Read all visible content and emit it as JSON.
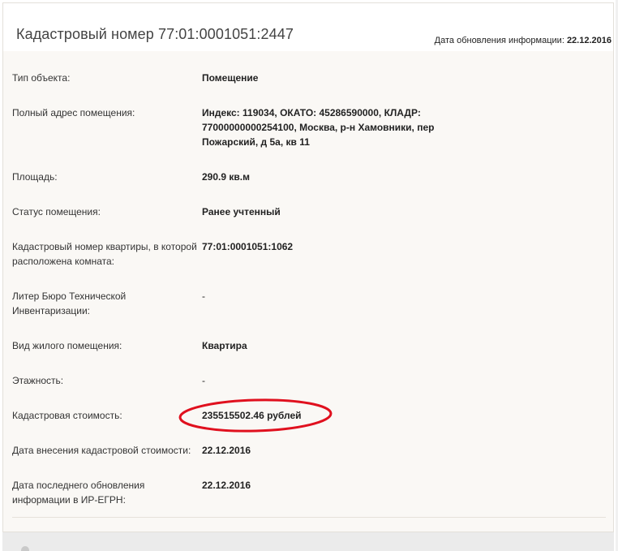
{
  "header": {
    "title": "Кадастровый номер 77:01:0001051:2447",
    "updated_label": "Дата обновления информации:",
    "updated_value": "22.12.2016"
  },
  "rows": [
    {
      "label": "Тип объекта:",
      "value": "Помещение"
    },
    {
      "label": "Полный адрес помещения:",
      "value": "Индекс: 119034, ОКАТО: 45286590000, КЛАДР: 77000000000254100, Москва, р-н Хамовники, пер Пожарский, д 5а, кв 11"
    },
    {
      "label": "Площадь:",
      "value": "290.9 кв.м"
    },
    {
      "label": "Статус помещения:",
      "value": "Ранее учтенный"
    },
    {
      "label": "Кадастровый номер квартиры, в которой расположена комната:",
      "value": "77:01:0001051:1062"
    },
    {
      "label": "Литер Бюро Технической Инвентаризации:",
      "value": "-"
    },
    {
      "label": "Вид жилого помещения:",
      "value": "Квартира"
    },
    {
      "label": "Этажность:",
      "value": "-"
    },
    {
      "label": "Кадастровая стоимость:",
      "value": "235515502.46 рублей"
    },
    {
      "label": "Дата внесения кадастровой стоимости:",
      "value": "22.12.2016"
    },
    {
      "label": "Дата последнего обновления информации в ИР-ЕГРН:",
      "value": "22.12.2016"
    }
  ],
  "annotation": {
    "color": "#e0101e"
  }
}
